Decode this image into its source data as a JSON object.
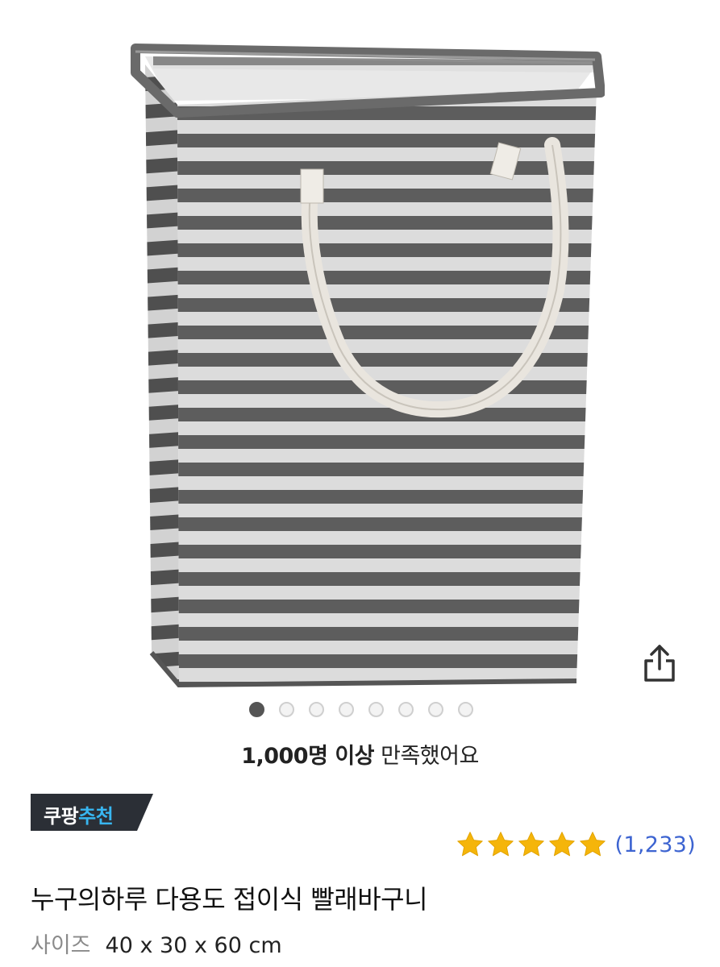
{
  "gallery": {
    "image_alt": "striped laundry basket with handles",
    "dot_count": 8,
    "active_index": 0
  },
  "satisfaction": {
    "bold": "1,000명 이상",
    "rest": " 만족했어요"
  },
  "badge": {
    "part1": "쿠팡",
    "part2": "추천",
    "bg_color": "#2b2f36",
    "accent_color": "#38b6f0"
  },
  "rating": {
    "stars": 5,
    "star_color": "#f5b50a",
    "count": "(1,233)"
  },
  "product": {
    "title": "누구의하루 다용도 접이식 빨래바구니"
  },
  "spec": {
    "label": "사이즈",
    "value": "40 x 30 x 60 cm"
  },
  "icons": {
    "share": "share-icon"
  }
}
